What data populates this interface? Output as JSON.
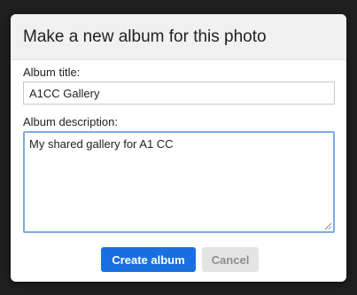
{
  "dialog": {
    "title": "Make a new album for this photo",
    "album_title_label": "Album title:",
    "album_title_value": "A1CC Gallery",
    "album_description_label": "Album description:",
    "album_description_value": "My shared gallery for A1 CC",
    "create_button_label": "Create album",
    "cancel_button_label": "Cancel"
  },
  "colors": {
    "primary_button": "#1a6fe0",
    "focus_border": "#7fa9e8",
    "header_background": "#f1f1f1",
    "overlay_background": "#1f1f1f"
  },
  "icons": [
    "resize-grip-icon"
  ]
}
